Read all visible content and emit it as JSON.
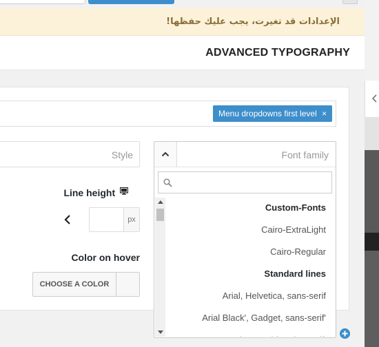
{
  "notice": {
    "text": "الإعدادات قد تغيرت، يجب عليك حفظها!"
  },
  "header": {
    "title": "ADVANCED TYPOGRAPHY"
  },
  "selector": {
    "tag_label": "Menu dropdowns first level",
    "tag_remove": "×"
  },
  "style_select": {
    "label": "Style"
  },
  "line_height": {
    "label": "Line height",
    "value": "",
    "unit": "px"
  },
  "color_hover": {
    "label": "Color on hover",
    "button_label": "CHOOSE A COLOR"
  },
  "font_family": {
    "label": "Font family",
    "search_value": "",
    "options": [
      {
        "label": "Custom-Fonts",
        "group": true
      },
      {
        "label": "Cairo-ExtraLight",
        "group": false
      },
      {
        "label": "Cairo-Regular",
        "group": false
      },
      {
        "label": "Standard lines",
        "group": true
      },
      {
        "label": "Arial, Helvetica, sans-serif",
        "group": false
      },
      {
        "label": "Arial Black', Gadget, sans-serif'",
        "group": false
      },
      {
        "label": "Bookman Old Style', serif'",
        "group": false
      }
    ]
  },
  "colors": {
    "accent": "#3e8ecb",
    "notice_bg": "#fcf2d9",
    "notice_text": "#8a6d3b"
  },
  "icons": {
    "monitor": "monitor-icon",
    "chevron_left": "chevron-left-icon",
    "chevron_up": "chevron-up-icon",
    "search": "search-icon",
    "plus": "plus-circle-icon"
  }
}
